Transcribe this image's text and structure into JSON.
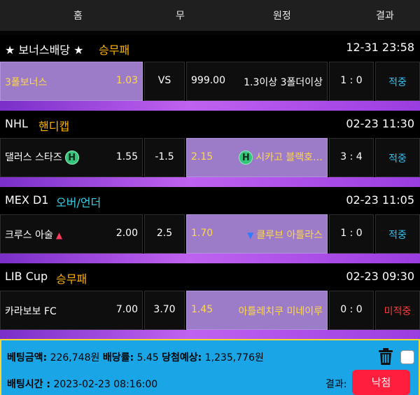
{
  "header": {
    "home": "홈",
    "draw": "무",
    "away": "원정",
    "result": "결과"
  },
  "sections": [
    {
      "league": "★ 보너스배당 ★",
      "market": "승무패",
      "time": "12-31 23:58",
      "home_team": "3폴보너스",
      "home_odds": "1.03",
      "middle": "VS",
      "away_odds": "999.00",
      "away_team": "1.3이상 3폴더이상",
      "score": "1 : 0",
      "result": "적중"
    },
    {
      "league": "NHL",
      "market": "핸디캡",
      "time": "02-23 11:30",
      "home_team": "댈러스 스타즈",
      "home_badge": "H",
      "home_odds": "1.55",
      "middle": "-1.5",
      "away_odds": "2.15",
      "away_badge": "H",
      "away_team": "시카고 블랙호…",
      "score": "3 : 4",
      "result": "적중"
    },
    {
      "league": "MEX D1",
      "market": "오버/언더",
      "time": "02-23 11:05",
      "home_team": "크루스 아술",
      "home_odds": "2.00",
      "middle": "2.5",
      "away_odds": "1.70",
      "away_team": "클루브 아틀라스",
      "score": "1 : 0",
      "result": "적중"
    },
    {
      "league": "LIB Cup",
      "market": "승무패",
      "time": "02-23 09:30",
      "home_team": "카라보보 FC",
      "home_odds": "7.00",
      "middle": "3.70",
      "away_odds": "1.45",
      "away_team": "아틀레치쿠 미네이루",
      "score": "0 : 0",
      "result": "미적중"
    }
  ],
  "summary": {
    "bet_amount_label": "베팅금액:",
    "bet_amount": "226,748원",
    "odds_label": "배당률:",
    "odds": "5.45",
    "expected_label": "당첨예상:",
    "expected": "1,235,776원",
    "bet_time_label": "배팅시간 :",
    "bet_time": "2023-02-23 08:16:00",
    "result_label": "결과:",
    "result_button": "낙첨"
  },
  "icons": {
    "trash": "trash-icon",
    "up": "triangle-up-icon",
    "down": "triangle-down-icon"
  },
  "colors": {
    "selected": "#9c7cc8",
    "hit": "#33c3f0",
    "miss": "#ff1f3d",
    "accent": "#1aa5e6"
  }
}
